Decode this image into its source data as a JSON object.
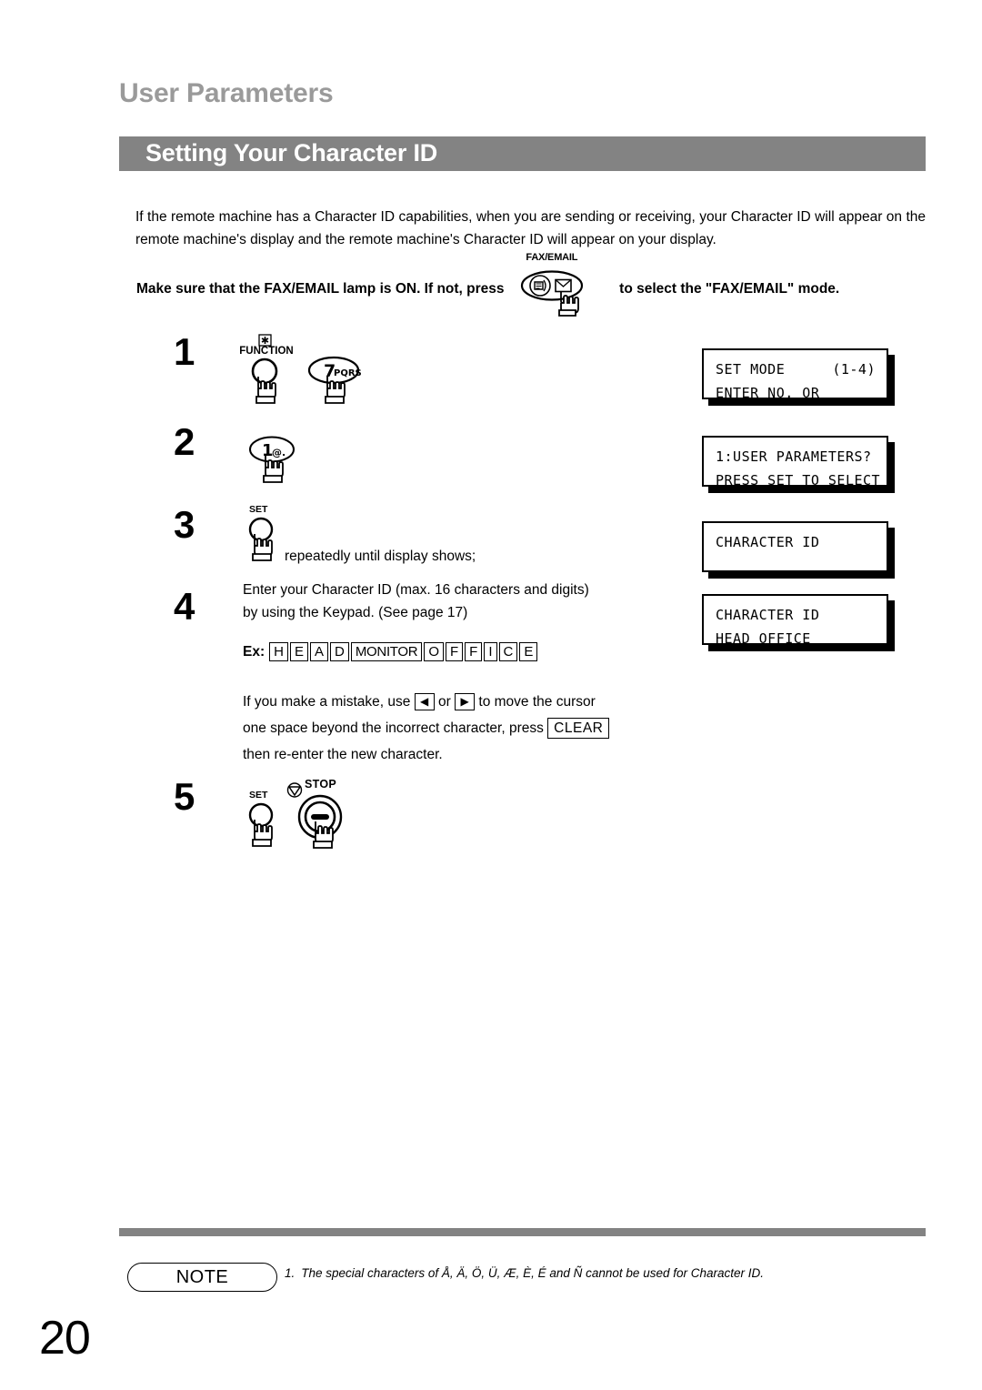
{
  "header": {
    "chapter_title": "User Parameters",
    "section_title": "Setting Your Character ID"
  },
  "intro": {
    "paragraph": "If the remote machine has a Character ID capabilities, when you are sending or receiving, your Character ID will appear on the remote machine's display and the remote machine's Character ID will appear on your display."
  },
  "lamp_instruction": {
    "before": "Make sure that the FAX/EMAIL lamp is ON.  If not, press",
    "after": "to select the \"FAX/EMAIL\" mode.",
    "button_label": "FAX/EMAIL"
  },
  "steps": [
    {
      "number": "1",
      "keys": [
        {
          "label_top": "FUNCTION",
          "face": "",
          "shape": "round",
          "icon": "asterisk-key-icon"
        },
        {
          "label_top": "",
          "face": "7",
          "sub": "PQRS",
          "shape": "oval"
        }
      ],
      "text": "",
      "lcd": {
        "line1_left": "SET MODE",
        "line1_right": "(1-4)",
        "line2": "ENTER NO. OR"
      }
    },
    {
      "number": "2",
      "keys": [
        {
          "label_top": "",
          "face": "1",
          "sub": "@.",
          "shape": "oval"
        }
      ],
      "text": "",
      "lcd": {
        "line1_left": "1:USER PARAMETERS?",
        "line1_right": "",
        "line2": "PRESS SET TO SELECT"
      }
    },
    {
      "number": "3",
      "keys": [
        {
          "label_top": "SET",
          "face": "",
          "shape": "round"
        }
      ],
      "text": "repeatedly until display shows;",
      "lcd": {
        "line1_left": "CHARACTER ID",
        "line1_right": "",
        "line2": ""
      }
    },
    {
      "number": "4",
      "keys": [],
      "text_line1": "Enter your Character ID (max. 16 characters and digits)",
      "text_line2": "by using the Keypad. (See page 17)",
      "lcd": {
        "line1_left": "CHARACTER ID",
        "line1_right": "",
        "line2": "HEAD OFFICE"
      }
    },
    {
      "number": "5",
      "keys": [
        {
          "label_top": "SET",
          "face": "",
          "shape": "round"
        },
        {
          "label_top": "STOP",
          "face": "",
          "shape": "round-stop",
          "icon": "stop-icon"
        }
      ],
      "text": "",
      "lcd": null
    }
  ],
  "example": {
    "label": "Ex:",
    "keys": [
      "H",
      "E",
      "A",
      "D",
      "MONITOR",
      "O",
      "F",
      "F",
      "I",
      "C",
      "E"
    ]
  },
  "mistake": {
    "part1": "If you make a mistake, use",
    "left_arrow": "◀",
    "or": "or",
    "right_arrow": "▶",
    "part2": "to move the cursor",
    "part3": "one space beyond the incorrect character, press",
    "clear_label": "CLEAR",
    "part4": "then re-enter the new character."
  },
  "footer": {
    "note_badge": "NOTE",
    "note_number": "1.",
    "note_text": "The special characters of Å, Ä, Ö, Ü, Æ, È, É and Ñ cannot be used for Character ID.",
    "page_number": "20"
  },
  "colors": {
    "band_gray": "#838383",
    "chapter_gray": "#9a9a9a"
  }
}
